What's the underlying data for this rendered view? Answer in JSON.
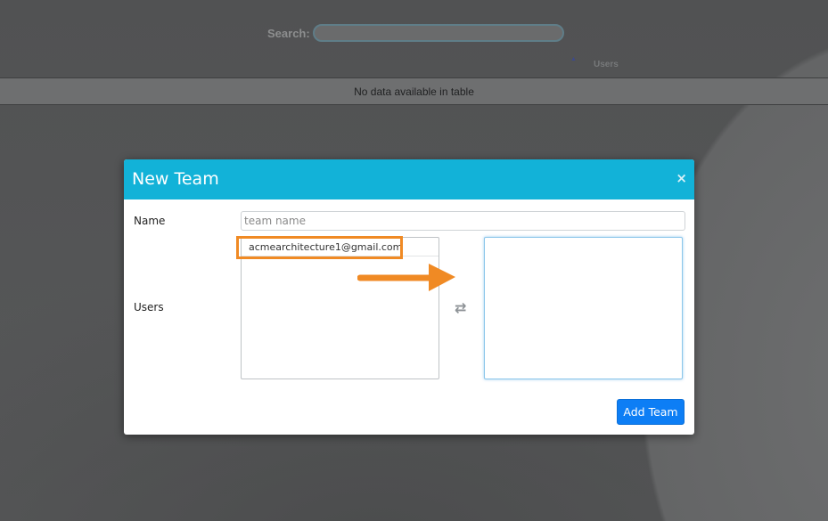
{
  "search": {
    "label": "Search:",
    "value": ""
  },
  "table": {
    "columns": [
      "Users"
    ],
    "empty_message": "No data available in table"
  },
  "modal": {
    "title": "New Team",
    "close_symbol": "×",
    "name_label": "Name",
    "name_placeholder": "team name",
    "name_value": "",
    "users_label": "Users",
    "available_users": [
      "acmearchitecture1@gmail.com"
    ],
    "selected_users": [],
    "submit_label": "Add Team"
  },
  "icons": {
    "sort": "sort-up-icon",
    "swap": "swap-icon",
    "close": "close-icon",
    "annotation": "arrow-right-icon"
  },
  "colors": {
    "modal_header": "#12b2d8",
    "primary_button": "#0d7ef5",
    "annotation": "#f08a24"
  }
}
